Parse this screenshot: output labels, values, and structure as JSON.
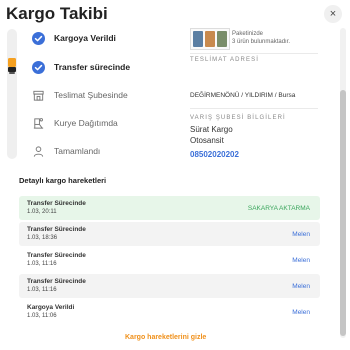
{
  "header": {
    "title": "Kargo Takibi",
    "close_label": "×"
  },
  "steps": [
    {
      "label": "Kargoya Verildi",
      "status": "done",
      "icon": "check-circle-icon"
    },
    {
      "label": "Transfer sürecinde",
      "status": "done",
      "icon": "check-circle-icon"
    },
    {
      "label": "Teslimat Şubesinde",
      "status": "todo",
      "icon": "store-icon"
    },
    {
      "label": "Kurye Dağıtımda",
      "status": "todo",
      "icon": "courier-icon"
    },
    {
      "label": "Tamamlandı",
      "status": "todo",
      "icon": "person-icon"
    }
  ],
  "package": {
    "line1": "Paketinizde",
    "line2": "3 ürün bulunmaktadır."
  },
  "delivery": {
    "heading": "TESLİMAT ADRESİ",
    "address": "DEĞİRMENÖNÜ / YILDIRIM / Bursa"
  },
  "branch": {
    "heading": "VARIŞ ŞUBESİ BİLGİLERİ",
    "carrier": "Sürat Kargo",
    "name": "Otosansit",
    "phone": "08502020202"
  },
  "history": {
    "title": "Detaylı kargo hareketleri",
    "rows": [
      {
        "status": "Transfer Sürecinde",
        "time": "1.03, 20:11",
        "location": "SAKARYA AKTARMA"
      },
      {
        "status": "Transfer Sürecinde",
        "time": "1.03, 18:36",
        "location": "Melen"
      },
      {
        "status": "Transfer Sürecinde",
        "time": "1.03, 11:16",
        "location": "Melen"
      },
      {
        "status": "Transfer Sürecinde",
        "time": "1.03, 11:16",
        "location": "Melen"
      },
      {
        "status": "Kargoya Verildi",
        "time": "1.03, 11:06",
        "location": "Melen"
      }
    ],
    "toggle_label": "Kargo hareketlerini gizle"
  },
  "colors": {
    "accent_blue": "#3b6fd8",
    "accent_orange": "#f0901a",
    "success_green": "#3aa55c"
  }
}
